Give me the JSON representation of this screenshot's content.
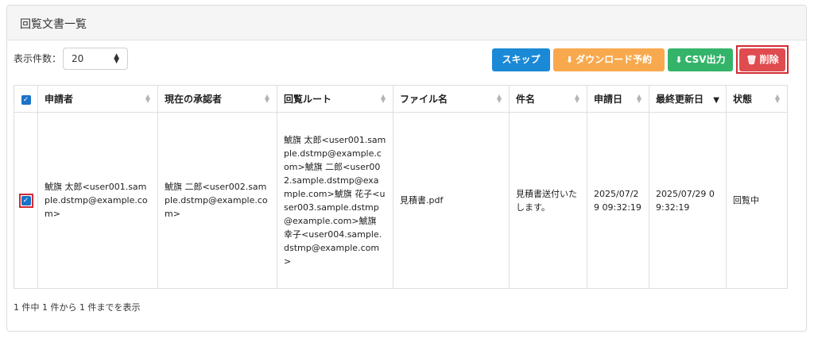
{
  "panel": {
    "title": "回覧文書一覧"
  },
  "per_page": {
    "label": "表示件数：",
    "value": "20"
  },
  "toolbar": {
    "skip_label": "スキップ",
    "download_label": "ダウンロード予約",
    "csv_label": "CSV出力",
    "delete_label": "削除"
  },
  "table": {
    "columns": [
      "申請者",
      "現在の承認者",
      "回覧ルート",
      "ファイル名",
      "件名",
      "申請日",
      "最終更新日",
      "状態"
    ],
    "rows": [
      {
        "applicant": "鯱旗 太郎<user001.sample.dstmp@example.com>",
        "approver": "鯱旗 二郎<user002.sample.dstmp@example.com>",
        "route": "鯱旗 太郎<user001.sample.dstmp@example.com>鯱旗 二郎<user002.sample.dstmp@example.com>鯱旗 花子<user003.sample.dstmp@example.com>鯱旗 幸子<user004.sample.dstmp@example.com>",
        "filename": "見積書.pdf",
        "subject": "見積書送付いたします。",
        "applied_date": "2025/07/29 09:32:19",
        "updated_date": "2025/07/29 09:32:19",
        "status": "回覧中"
      }
    ]
  },
  "footer": {
    "summary": "1 件中 1 件から 1 件までを表示"
  },
  "colors": {
    "primary": "#1a89d6",
    "warning": "#f9a94d",
    "success": "#34b46a",
    "danger": "#e04b4f",
    "highlight": "#d22b33"
  },
  "icons": {
    "download": "download-icon",
    "trash": "trash-icon",
    "checkbox": "checkbox-checked-icon"
  }
}
